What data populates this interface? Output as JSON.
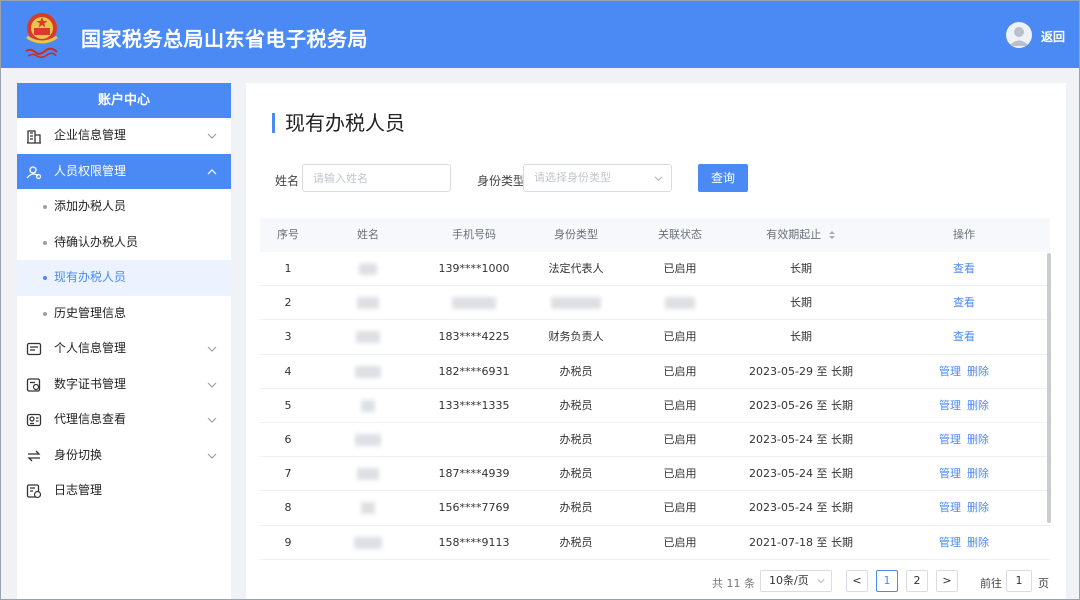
{
  "header": {
    "site_title": "国家税务总局山东省电子税务局",
    "back_label": "返回",
    "brand_color": "#4b8af4"
  },
  "sidebar": {
    "title": "账户中心",
    "items": [
      {
        "label": "企业信息管理",
        "icon": "building-icon",
        "state": "collapsed"
      },
      {
        "label": "人员权限管理",
        "icon": "user-settings-icon",
        "state": "expanded-active"
      },
      {
        "label": "个人信息管理",
        "icon": "id-card-icon",
        "state": "collapsed"
      },
      {
        "label": "数字证书管理",
        "icon": "certificate-icon",
        "state": "collapsed"
      },
      {
        "label": "代理信息查看",
        "icon": "agent-icon",
        "state": "collapsed"
      },
      {
        "label": "身份切换",
        "icon": "switch-icon",
        "state": "collapsed"
      },
      {
        "label": "日志管理",
        "icon": "log-icon",
        "state": "none"
      }
    ],
    "sub_items": [
      {
        "label": "添加办税人员"
      },
      {
        "label": "待确认办税人员"
      },
      {
        "label": "现有办税人员",
        "current": true
      },
      {
        "label": "历史管理信息"
      }
    ]
  },
  "main": {
    "page_title": "现有办税人员",
    "filters": {
      "name_label": "姓名",
      "name_placeholder": "请输入姓名",
      "type_label": "身份类型",
      "type_placeholder": "请选择身份类型",
      "query_label": "查询"
    },
    "table": {
      "headers": [
        "序号",
        "姓名",
        "手机号码",
        "身份类型",
        "关联状态",
        "有效期起止",
        "操作"
      ],
      "sort_icon": "sort-icon",
      "rows": [
        {
          "no": "1",
          "phone": "139****1000",
          "type": "法定代表人",
          "status": "已启用",
          "period": "长期",
          "actions": [
            "查看"
          ]
        },
        {
          "no": "2",
          "phone": "",
          "type": "",
          "status": "",
          "period": "长期",
          "actions": [
            "查看"
          ]
        },
        {
          "no": "3",
          "phone": "183****4225",
          "type": "财务负责人",
          "status": "已启用",
          "period": "长期",
          "actions": [
            "查看"
          ]
        },
        {
          "no": "4",
          "phone": "182****6931",
          "type": "办税员",
          "status": "已启用",
          "period": "2023-05-29 至 长期",
          "actions": [
            "管理",
            "删除"
          ]
        },
        {
          "no": "5",
          "phone": "133****1335",
          "type": "办税员",
          "status": "已启用",
          "period": "2023-05-26 至 长期",
          "actions": [
            "管理",
            "删除"
          ]
        },
        {
          "no": "6",
          "phone": "",
          "type": "办税员",
          "status": "已启用",
          "period": "2023-05-24 至 长期",
          "actions": [
            "管理",
            "删除"
          ]
        },
        {
          "no": "7",
          "phone": "187****4939",
          "type": "办税员",
          "status": "已启用",
          "period": "2023-05-24 至 长期",
          "actions": [
            "管理",
            "删除"
          ]
        },
        {
          "no": "8",
          "phone": "156****7769",
          "type": "办税员",
          "status": "已启用",
          "period": "2023-05-24 至 长期",
          "actions": [
            "管理",
            "删除"
          ]
        },
        {
          "no": "9",
          "phone": "158****9113",
          "type": "办税员",
          "status": "已启用",
          "period": "2021-07-18 至 长期",
          "actions": [
            "管理",
            "删除"
          ]
        }
      ]
    },
    "pagination": {
      "total": "共 11 条",
      "page_size": "10条/页",
      "prev": "<",
      "pages": [
        "1",
        "2"
      ],
      "current_page": "1",
      "next": ">",
      "goto_label": "前往",
      "goto_value": "1",
      "page_suffix": "页"
    }
  }
}
